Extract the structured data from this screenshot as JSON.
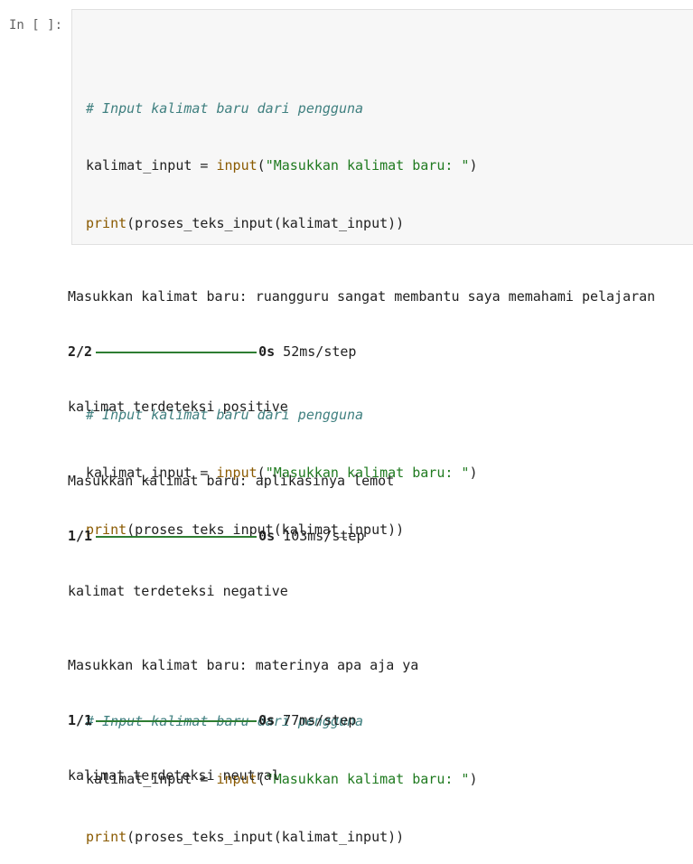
{
  "cell": {
    "prompt": "In [ ]:",
    "blocks": [
      {
        "comment": "# Input kalimat baru dari pengguna",
        "var": "kalimat_input",
        "eq": " = ",
        "fn_input": "input",
        "open1": "(",
        "string": "\"Masukkan kalimat baru: \"",
        "close1": ")",
        "fn_print": "print",
        "print_args": "(proses_teks_input(kalimat_input))"
      },
      {
        "comment": "# Input kalimat baru dari pengguna",
        "var": "kalimat_input",
        "eq": " = ",
        "fn_input": "input",
        "open1": "(",
        "string": "\"Masukkan kalimat baru: \"",
        "close1": ")",
        "fn_print": "print",
        "print_args": "(proses_teks_input(kalimat_input))"
      },
      {
        "comment": "# Input kalimat baru dari pengguna",
        "var": "kalimat_input",
        "eq": " = ",
        "fn_input": "input",
        "open1": "(",
        "string": "\"Masukkan kalimat baru: \"",
        "close1": ")",
        "fn_print": "print",
        "print_args": "(proses_teks_input(kalimat_input))"
      }
    ]
  },
  "output": [
    {
      "input_line": "Masukkan kalimat baru: ruangguru sangat membantu saya memahami pelajaran",
      "step_count": "2/2",
      "step_time": "0s",
      "step_rate": " 52ms/step",
      "result": "kalimat terdeteksi positive"
    },
    {
      "input_line": "Masukkan kalimat baru: aplikasinya lemot",
      "step_count": "1/1",
      "step_time": "0s",
      "step_rate": " 103ms/step",
      "result": "kalimat terdeteksi negative"
    },
    {
      "input_line": "Masukkan kalimat baru: materinya apa aja ya",
      "step_count": "1/1",
      "step_time": "0s",
      "step_rate": " 77ms/step",
      "result": "kalimat terdeteksi neutral"
    }
  ],
  "colors": {
    "comment": "#408080",
    "function": "#8a5a00",
    "string": "#1f7a1f",
    "progress": "#2e7d32"
  }
}
